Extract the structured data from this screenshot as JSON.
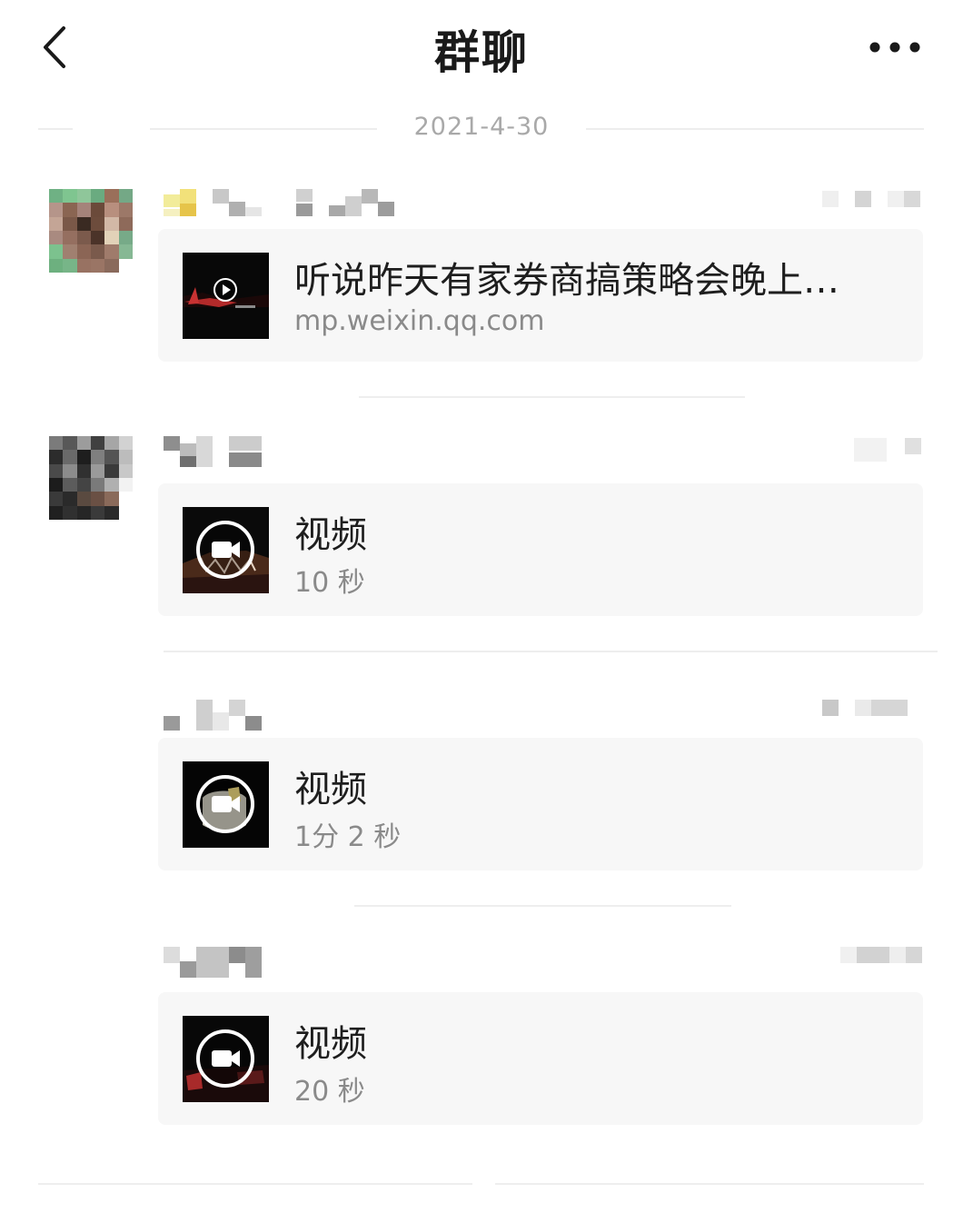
{
  "header": {
    "title": "群聊",
    "back_icon": "chevron-left-icon",
    "more_icon": "more-dots-icon"
  },
  "date_divider": "2021-4-30",
  "messages": [
    {
      "type": "link",
      "title": "听说昨天有家券商搞策略会晚上…",
      "subtitle": "mp.weixin.qq.com",
      "thumb_icon": "play-icon"
    },
    {
      "type": "video",
      "title": "视频",
      "subtitle": "10 秒",
      "thumb_icon": "video-camera-icon"
    },
    {
      "type": "video",
      "title": "视频",
      "subtitle": "1分 2 秒",
      "thumb_icon": "video-camera-icon"
    },
    {
      "type": "video",
      "title": "视频",
      "subtitle": "20 秒",
      "thumb_icon": "video-camera-icon"
    }
  ],
  "colors": {
    "card_bg": "#f7f7f7",
    "secondary_text": "#8a8a8a",
    "date_text": "#a9a9a9"
  }
}
